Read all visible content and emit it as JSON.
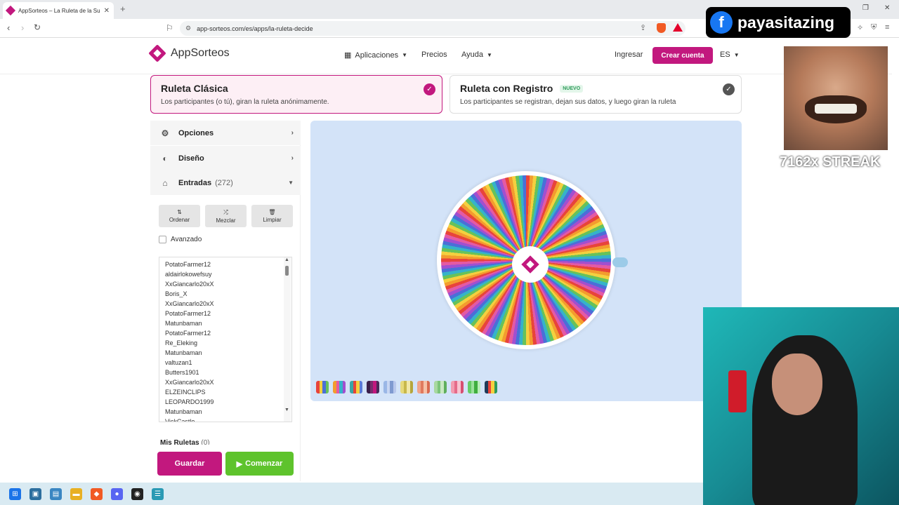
{
  "browser": {
    "tab_title": "AppSorteos – La Ruleta de la Su",
    "url": "app-sorteos.com/es/apps/la-ruleta-decide"
  },
  "header": {
    "logo_text": "AppSorteos",
    "nav": {
      "aplicaciones": "Aplicaciones",
      "precios": "Precios",
      "ayuda": "Ayuda",
      "ingresar": "Ingresar",
      "crear_cuenta": "Crear cuenta",
      "lang": "ES"
    }
  },
  "modes": [
    {
      "title": "Ruleta Clásica",
      "desc": "Los participantes (o tú), giran la ruleta anónimamente.",
      "selected": true
    },
    {
      "title": "Ruleta con Registro",
      "badge": "NUEVO",
      "desc": "Los participantes se registran, dejan sus datos, y luego giran la ruleta",
      "selected": false
    }
  ],
  "panel": {
    "opciones": "Opciones",
    "diseno": "Diseño",
    "entradas": "Entradas",
    "entradas_count": "(272)",
    "tools": {
      "ordenar": "Ordenar",
      "mezclar": "Mezclar",
      "limpiar": "Limpiar"
    },
    "avanzado": "Avanzado",
    "entries": [
      "PotatoFarmer12",
      "aldairlokowefsuy",
      "XxGiancarlo20xX",
      "Boris_X",
      "XxGiancarlo20xX",
      "PotatoFarmer12",
      "Matunbaman",
      "PotatoFarmer12",
      "Re_Eleking",
      "Matunbaman",
      "valtuzan1",
      "Butters1901",
      "XxGiancarlo20xX",
      "ELZEINCLIPS",
      "LEOPARDO1999",
      "Matunbaman",
      "VickCastle"
    ],
    "mis_ruletas": "Mis Ruletas",
    "mis_ruletas_count": "(0)",
    "guardar": "Guardar",
    "comenzar": "Comenzar"
  },
  "colors": {
    "brand": "#c2187e",
    "start_green": "#5ec32c",
    "stage_bg": "#d3e3f8"
  },
  "overlay": {
    "facebook_name": "payasitazing",
    "streak": "7162x STREAK"
  }
}
